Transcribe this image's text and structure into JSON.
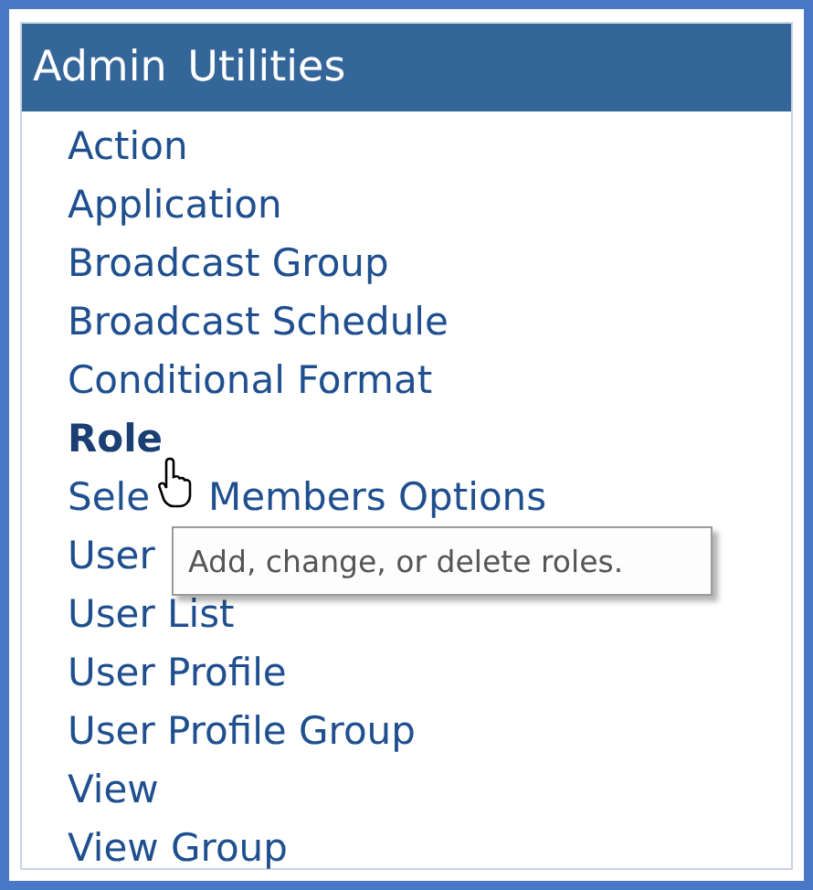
{
  "panel": {
    "title": "Admin Utilities"
  },
  "items": [
    {
      "label": "Action",
      "hovered": false
    },
    {
      "label": "Application",
      "hovered": false
    },
    {
      "label": "Broadcast Group",
      "hovered": false
    },
    {
      "label": "Broadcast Schedule",
      "hovered": false
    },
    {
      "label": "Conditional Format",
      "hovered": false
    },
    {
      "label": "Role",
      "hovered": true
    },
    {
      "label": "Sele",
      "label_after_cursor": "Members Options",
      "hovered": false
    },
    {
      "label": "User",
      "hovered": false
    },
    {
      "label": "User List",
      "hovered": false
    },
    {
      "label": "User Profile",
      "hovered": false
    },
    {
      "label": "User Profile Group",
      "hovered": false
    },
    {
      "label": "View",
      "hovered": false
    },
    {
      "label": "View Group",
      "hovered": false
    }
  ],
  "tooltip": {
    "text": "Add, change, or delete roles."
  }
}
